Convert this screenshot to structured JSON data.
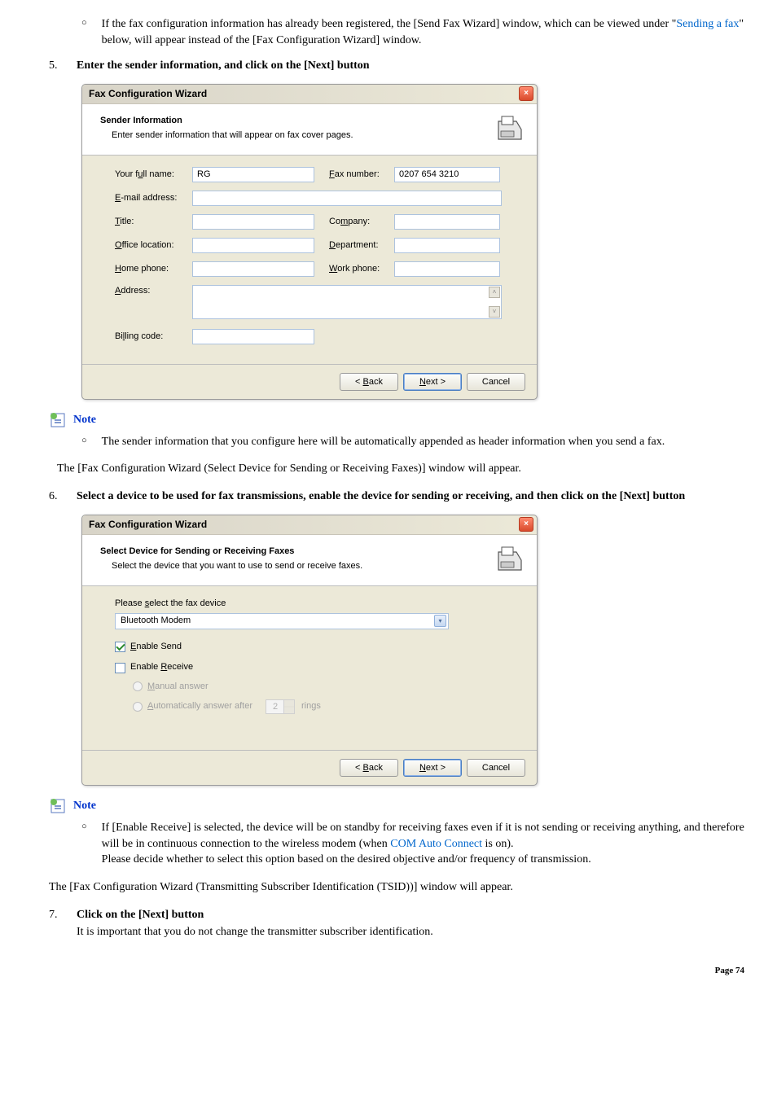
{
  "intro_bullet": {
    "pre": "If the fax configuration information has already been registered, the [Send Fax Wizard] window, which can be viewed under \"",
    "link": "Sending a fax",
    "post": "\" below, will appear instead of the [Fax Configuration Wizard] window."
  },
  "step5": {
    "num": "5.",
    "text": "Enter the sender information, and click on the [Next] button"
  },
  "wizard1": {
    "title": "Fax Configuration Wizard",
    "header_title": "Sender Information",
    "header_sub": "Enter sender information that will appear on fax cover pages.",
    "labels": {
      "full_name": "Your full name:",
      "fax_number": "Fax number:",
      "email": "E-mail address:",
      "title": "Title:",
      "company": "Company:",
      "office": "Office location:",
      "department": "Department:",
      "home_phone": "Home phone:",
      "work_phone": "Work phone:",
      "address": "Address:",
      "billing": "Billing code:"
    },
    "values": {
      "full_name": "RG",
      "fax_number": "0207 654 3210",
      "email": "",
      "title": "",
      "company": "",
      "office": "",
      "department": "",
      "home_phone": "",
      "work_phone": "",
      "billing": ""
    },
    "buttons": {
      "back": "< Back",
      "next": "Next >",
      "cancel": "Cancel"
    }
  },
  "note1": {
    "label": "Note",
    "text": "The sender information that you configure here will be automatically appended as header information when you send a fax."
  },
  "after_note1": "The [Fax Configuration Wizard (Select Device for Sending or Receiving Faxes)] window will appear.",
  "step6": {
    "num": "6.",
    "text": "Select a device to be used for fax transmissions, enable the device for sending or receiving, and then click on the [Next] button"
  },
  "wizard2": {
    "title": "Fax Configuration Wizard",
    "header_title": "Select Device for Sending or Receiving Faxes",
    "header_sub": "Select the device that you want to use to send or receive faxes.",
    "select_label": "Please select the fax device",
    "select_value": "Bluetooth Modem",
    "enable_send": "Enable Send",
    "enable_receive": "Enable Receive",
    "manual_answer": "Manual answer",
    "auto_answer": "Automatically answer after",
    "rings_value": "2",
    "rings_label": "rings",
    "buttons": {
      "back": "< Back",
      "next": "Next >",
      "cancel": "Cancel"
    }
  },
  "note2": {
    "label": "Note",
    "text_pre": "If [Enable Receive] is selected, the device will be on standby for receiving faxes even if it is not sending or receiving anything, and therefore will be in continuous connection to the wireless modem (when ",
    "link": "COM Auto Connect",
    "text_mid": " is on).",
    "text_line2": "Please decide whether to select this option based on the desired objective and/or frequency of transmission."
  },
  "after_note2": "The [Fax Configuration Wizard (Transmitting Subscriber Identification (TSID))] window will appear.",
  "step7": {
    "num": "7.",
    "text": "Click on the [Next] button",
    "sub": "It is important that you do not change the transmitter subscriber identification."
  },
  "page_num": "Page 74"
}
